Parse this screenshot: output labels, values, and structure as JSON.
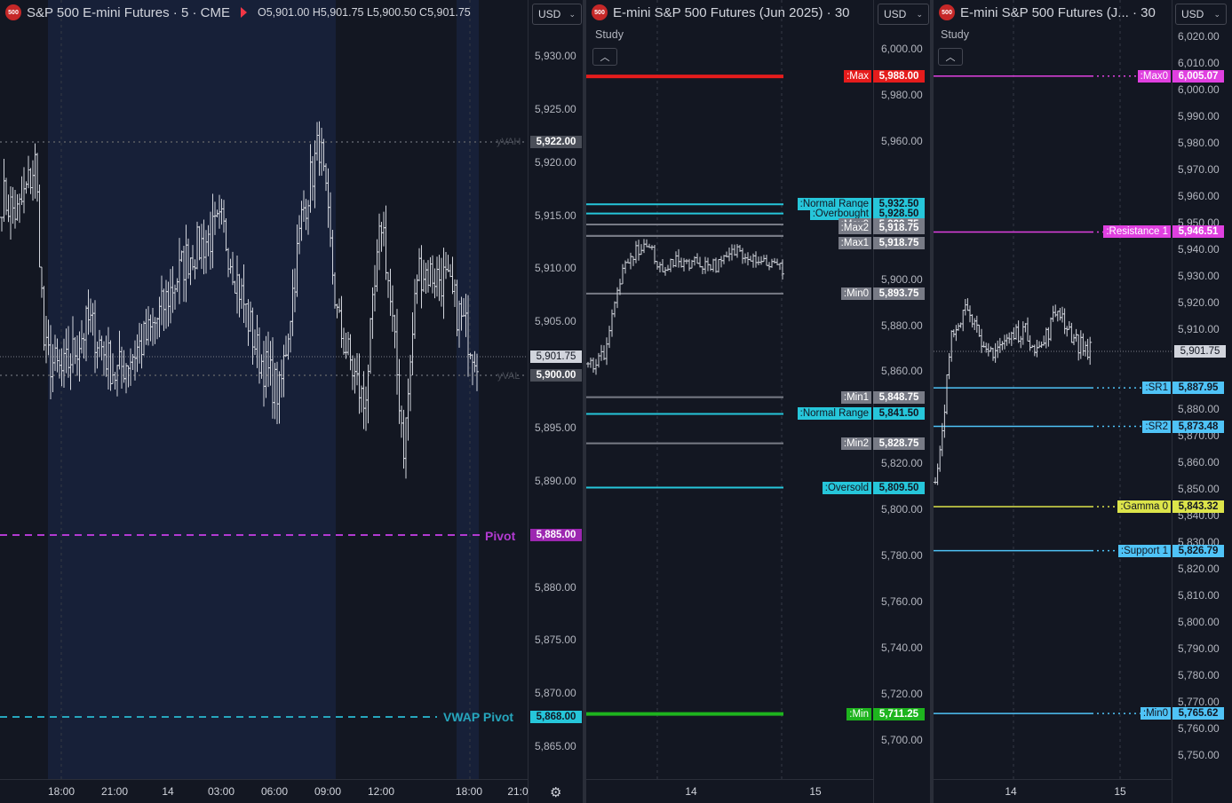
{
  "colors": {
    "background": "#131722",
    "grid": "#363a45",
    "candle": "#d1d4dc",
    "separator": "#2a2e39"
  },
  "panel1": {
    "logo": "500",
    "title": "S&P 500 E-mini Futures · 5 · CME",
    "ohlc": "O5,901.00  H5,901.75  L5,900.50  C5,901.75",
    "currency": "USD",
    "y_ticks": [
      "5,930.00",
      "5,925.00",
      "5,920.00",
      "5,915.00",
      "5,910.00",
      "5,905.00",
      "5,895.00",
      "5,890.00",
      "5,880.00",
      "5,875.00",
      "5,870.00",
      "5,865.00"
    ],
    "x_ticks": [
      "18:00",
      "21:00",
      "14",
      "03:00",
      "06:00",
      "09:00",
      "12:00",
      "18:00",
      "21:0"
    ],
    "yvah_label": "yVAH",
    "yval_label": "yVAL",
    "pivot_label": "Pivot",
    "vwap_pivot_label": "VWAP Pivot",
    "badges": {
      "yvah": "5,922.00",
      "last": "5,901.75",
      "yval": "5,900.00",
      "pivot": "5,885.00",
      "vwap_pivot": "5,868.00"
    }
  },
  "panel2": {
    "logo": "500",
    "title": "E-mini S&P 500 Futures (Jun 2025) · 30",
    "currency": "USD",
    "study_label": "Study",
    "y_ticks": [
      "6,000.00",
      "5,980.00",
      "5,960.00",
      "5,900.00",
      "5,880.00",
      "5,860.00",
      "5,820.00",
      "5,800.00",
      "5,780.00",
      "5,760.00",
      "5,740.00",
      "5,720.00",
      "5,700.00"
    ],
    "x_ticks": [
      "14",
      "15"
    ],
    "levels": [
      {
        "name": ":Max",
        "value": "5,988.00",
        "color": "#e51c1c",
        "text": "#ffffff"
      },
      {
        "name": ":Normal Range",
        "value": "5,932.50",
        "color": "#26c6da",
        "text": "#131722"
      },
      {
        "name": ":Overbought",
        "value": "5,928.50",
        "color": "#26c6da",
        "text": "#131722"
      },
      {
        "name": ":Max0",
        "value": "5,923.75",
        "color": "#787b86",
        "text": "#ffffff"
      },
      {
        "name": ":Max2",
        "value": "5,918.75",
        "color": "#787b86",
        "text": "#ffffff"
      },
      {
        "name": ":Max1",
        "value": "5,918.75",
        "color": "#787b86",
        "text": "#ffffff"
      },
      {
        "name": ":Min0",
        "value": "5,893.75",
        "color": "#787b86",
        "text": "#ffffff"
      },
      {
        "name": ":Min1",
        "value": "5,848.75",
        "color": "#787b86",
        "text": "#ffffff"
      },
      {
        "name": ":Normal Range",
        "value": "5,841.50",
        "color": "#26c6da",
        "text": "#131722"
      },
      {
        "name": ":Min2",
        "value": "5,828.75",
        "color": "#787b86",
        "text": "#ffffff"
      },
      {
        "name": ":Oversold",
        "value": "5,809.50",
        "color": "#26c6da",
        "text": "#131722"
      },
      {
        "name": ":Min",
        "value": "5,711.25",
        "color": "#1eb41e",
        "text": "#ffffff"
      }
    ]
  },
  "panel3": {
    "logo": "500",
    "title": "E-mini S&P 500 Futures (J... · 30",
    "currency": "USD",
    "study_label": "Study",
    "y_ticks": [
      "6,020.00",
      "6,010.00",
      "6,000.00",
      "5,990.00",
      "5,980.00",
      "5,970.00",
      "5,960.00",
      "5,950.00",
      "5,940.00",
      "5,930.00",
      "5,920.00",
      "5,910.00",
      "5,880.00",
      "5,870.00",
      "5,860.00",
      "5,850.00",
      "5,840.00",
      "5,830.00",
      "5,820.00",
      "5,810.00",
      "5,800.00",
      "5,790.00",
      "5,780.00",
      "5,770.00",
      "5,760.00",
      "5,750.00"
    ],
    "x_ticks": [
      "14",
      "15"
    ],
    "last": "5,901.75",
    "levels": [
      {
        "name": ":Max0",
        "value": "6,005.07",
        "color": "#e040e0",
        "text": "#ffffff"
      },
      {
        "name": ":Resistance 1",
        "value": "5,946.51",
        "color": "#e040e0",
        "text": "#ffffff"
      },
      {
        "name": ":SR1",
        "value": "5,887.95",
        "color": "#4fc3f7",
        "text": "#131722"
      },
      {
        "name": ":SR2",
        "value": "5,873.48",
        "color": "#4fc3f7",
        "text": "#131722"
      },
      {
        "name": ":Gamma 0",
        "value": "5,843.32",
        "color": "#dce44a",
        "text": "#131722"
      },
      {
        "name": ":Support 1",
        "value": "5,826.79",
        "color": "#4fc3f7",
        "text": "#131722"
      },
      {
        "name": ":Min0",
        "value": "5,765.62",
        "color": "#4fc3f7",
        "text": "#131722"
      }
    ]
  }
}
